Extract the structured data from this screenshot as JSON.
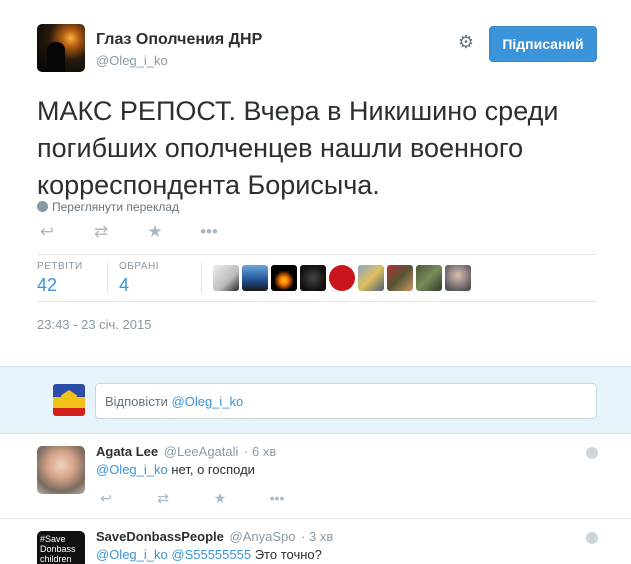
{
  "tweet": {
    "fullname": "Глаз Ополчения ДНР",
    "username": "@Oleg_i_ko",
    "follow_label": "Підписаний",
    "text": "МАКС РЕПОСТ. Вчера в Никишино среди погибших ополченцев нашли военного корреспондента Борисыча.",
    "translate_label": "Переглянути переклад",
    "stats": {
      "retweets_label": "РЕТВІТИ",
      "retweets_value": "42",
      "favorites_label": "ОБРАНІ",
      "favorites_value": "4"
    },
    "timestamp": "23:43 - 23 січ. 2015",
    "icons": {
      "gear": "gear-icon",
      "reply": "reply-icon",
      "retweet": "retweet-icon",
      "favorite": "star-icon",
      "more": "more-icon"
    }
  },
  "reply_box": {
    "prefix": "Відповісти ",
    "mention": "@Oleg_i_ko"
  },
  "replies": [
    {
      "name": "Agata Lee",
      "user": "@LeeAgatali",
      "time": "· 6 хв",
      "mention": "@Oleg_i_ko",
      "text": " нет, о господи"
    },
    {
      "name": "SaveDonbassPeople",
      "user": "@AnyaSpo",
      "time": "· 3 хв",
      "mention1": "@Oleg_i_ko",
      "mention2": "@S55555555",
      "text": " Это точно?",
      "avatar_text": "#Save Donbass children"
    }
  ],
  "colors": {
    "accent": "#3b94d9",
    "reply_bg": "#e8f4fb",
    "muted": "#8899a6"
  }
}
